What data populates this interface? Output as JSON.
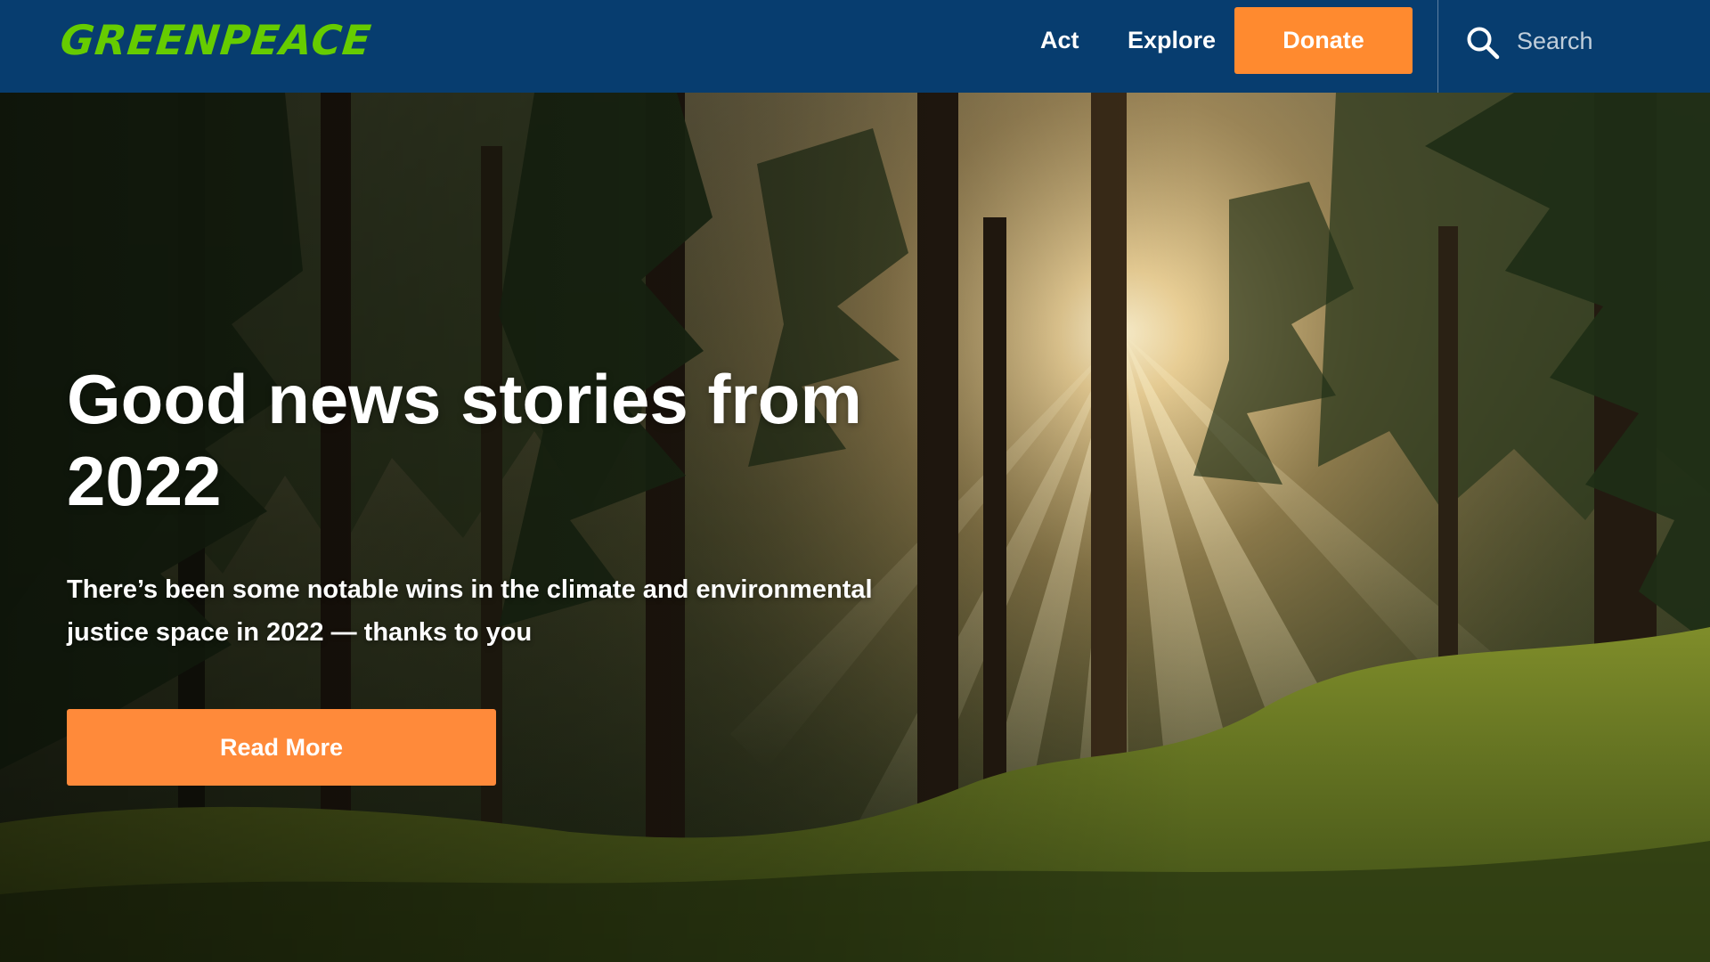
{
  "header": {
    "logo_text": "GREENPEACE",
    "nav": [
      {
        "label": "Act"
      },
      {
        "label": "Explore"
      }
    ],
    "donate_label": "Donate",
    "search": {
      "placeholder": "Search",
      "icon": "search-icon"
    }
  },
  "hero": {
    "background": "forest-with-sunbeams-photo",
    "title": "Good news stories from 2022",
    "subtitle": "There’s been some notable wins in the climate and environmental justice space in 2022 — thanks to you",
    "cta_label": "Read More"
  },
  "colors": {
    "header_bg": "#073d6f",
    "logo": "#66cc00",
    "accent_orange": "#ff8a2f",
    "text_light": "#ffffff"
  }
}
